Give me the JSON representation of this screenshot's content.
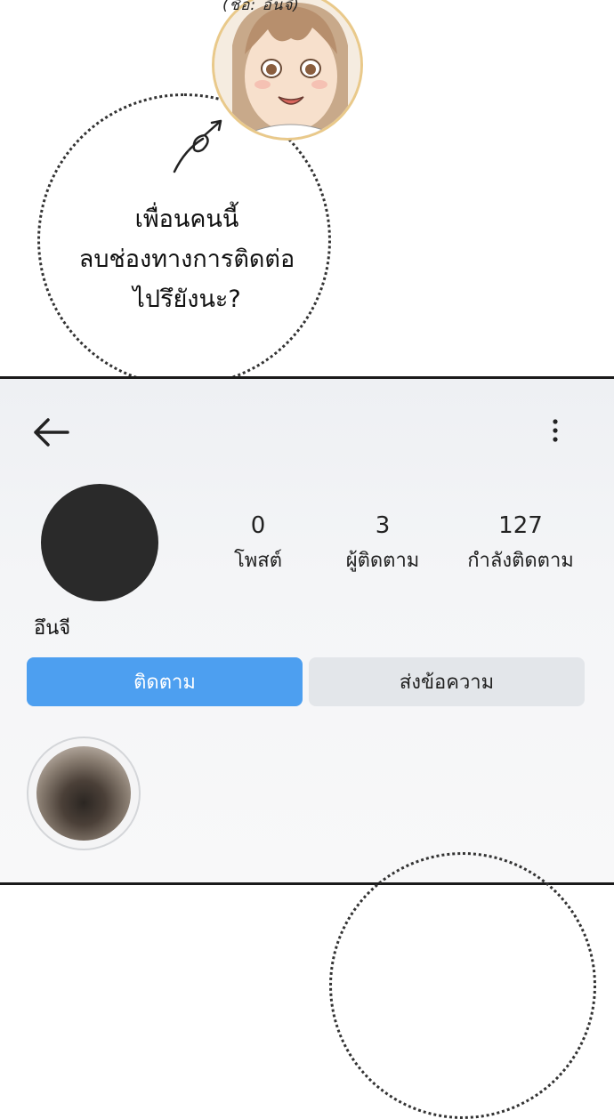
{
  "comic": {
    "top_caption": "(ชื่อ: อึนจี)",
    "bubble_lines": [
      "เพื่อนคนนี้",
      "ลบช่องทางการติดต่อ",
      "ไปรึยังนะ?"
    ]
  },
  "profile": {
    "icons": {
      "back": "back-arrow-icon",
      "more": "more-vertical-icon"
    },
    "stats": [
      {
        "value": "0",
        "label": "โพสต์"
      },
      {
        "value": "3",
        "label": "ผู้ติดตาม"
      },
      {
        "value": "127",
        "label": "กำลังติดตาม"
      }
    ],
    "username": "อึนจี",
    "follow_label": "ติดตาม",
    "message_label": "ส่งข้อความ",
    "colors": {
      "follow_button": "#4d9ff0",
      "message_button": "#e3e6ea"
    }
  }
}
